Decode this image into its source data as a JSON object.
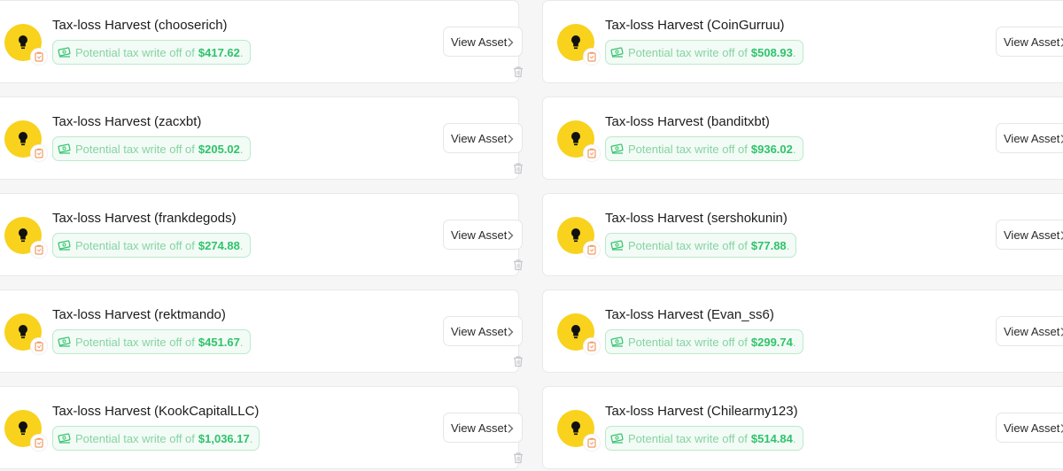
{
  "cards": [
    {
      "title": "Tax-loss Harvest (chooserich)",
      "amount": "$417.62"
    },
    {
      "title": "Tax-loss Harvest (CoinGurruu)",
      "amount": "$508.93"
    },
    {
      "title": "Tax-loss Harvest (zacxbt)",
      "amount": "$205.02"
    },
    {
      "title": "Tax-loss Harvest (banditxbt)",
      "amount": "$936.02"
    },
    {
      "title": "Tax-loss Harvest (frankdegods)",
      "amount": "$274.88"
    },
    {
      "title": "Tax-loss Harvest (sershokunin)",
      "amount": "$77.88"
    },
    {
      "title": "Tax-loss Harvest (rektmando)",
      "amount": "$451.67"
    },
    {
      "title": "Tax-loss Harvest (Evan_ss6)",
      "amount": "$299.74"
    },
    {
      "title": "Tax-loss Harvest (KookCapitalLLC)",
      "amount": "$1,036.17"
    },
    {
      "title": "Tax-loss Harvest (Chilearmy123)",
      "amount": "$514.84"
    }
  ],
  "labels": {
    "write_off_prefix": "Potential tax write off of",
    "period": ".",
    "view_asset": "View Asset"
  },
  "icons": {
    "avatar": "lightbulb-icon",
    "badge": "clipboard-icon",
    "money": "money-icon",
    "action_chevron": "chevron-right-icon",
    "delete": "trash-icon"
  },
  "colors": {
    "avatar_bg": "#f8d21c",
    "amount_green": "#2fc36c",
    "pill_text": "#86d3a4",
    "pill_border": "#bde9cd",
    "badge_orange": "#f19a62"
  }
}
